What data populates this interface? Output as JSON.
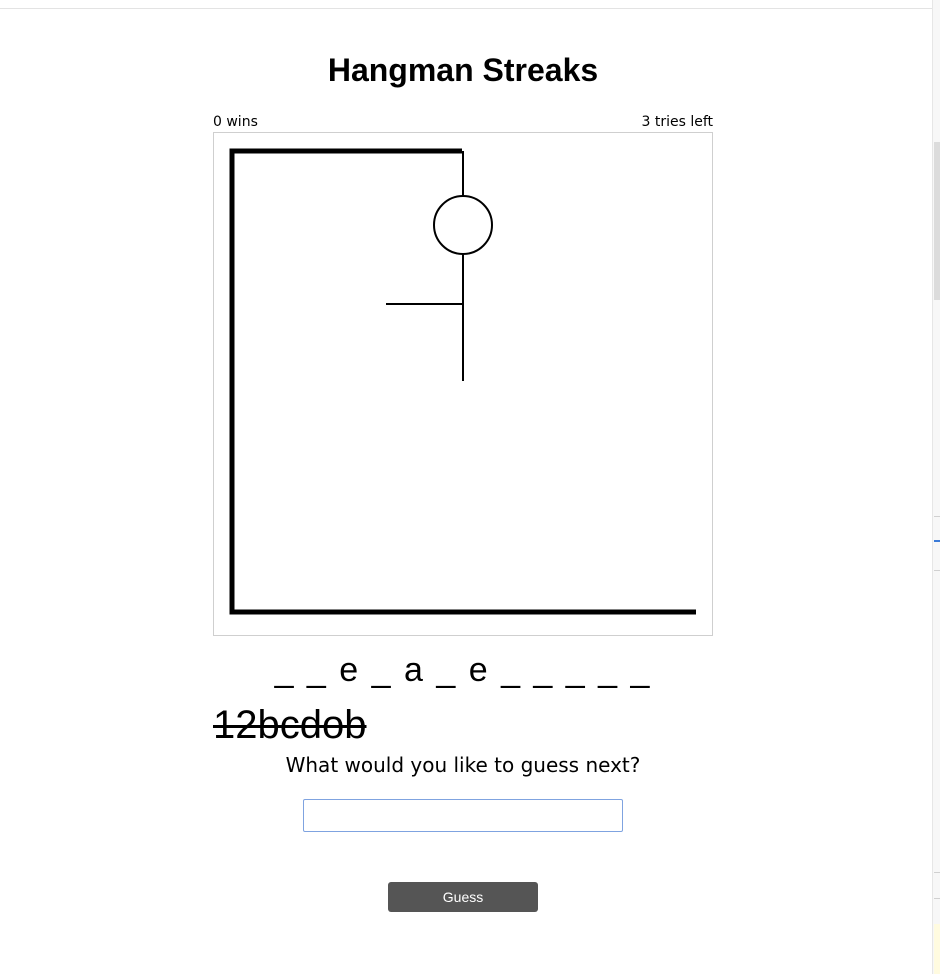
{
  "title": "Hangman Streaks",
  "status": {
    "wins": "0 wins",
    "tries": "3 tries left"
  },
  "hangman": {
    "parts_drawn": [
      "gallows",
      "head",
      "body",
      "left-arm"
    ]
  },
  "word_display": "_ _ e _ a _ e _ _ _ _ _",
  "guessed_letters": "12bcdob",
  "prompt": "What would you like to guess next?",
  "guess_input": {
    "value": "",
    "placeholder": ""
  },
  "guess_button_label": "Guess",
  "colors": {
    "button_bg": "#555555",
    "input_focus_border": "#7fa3e0"
  }
}
